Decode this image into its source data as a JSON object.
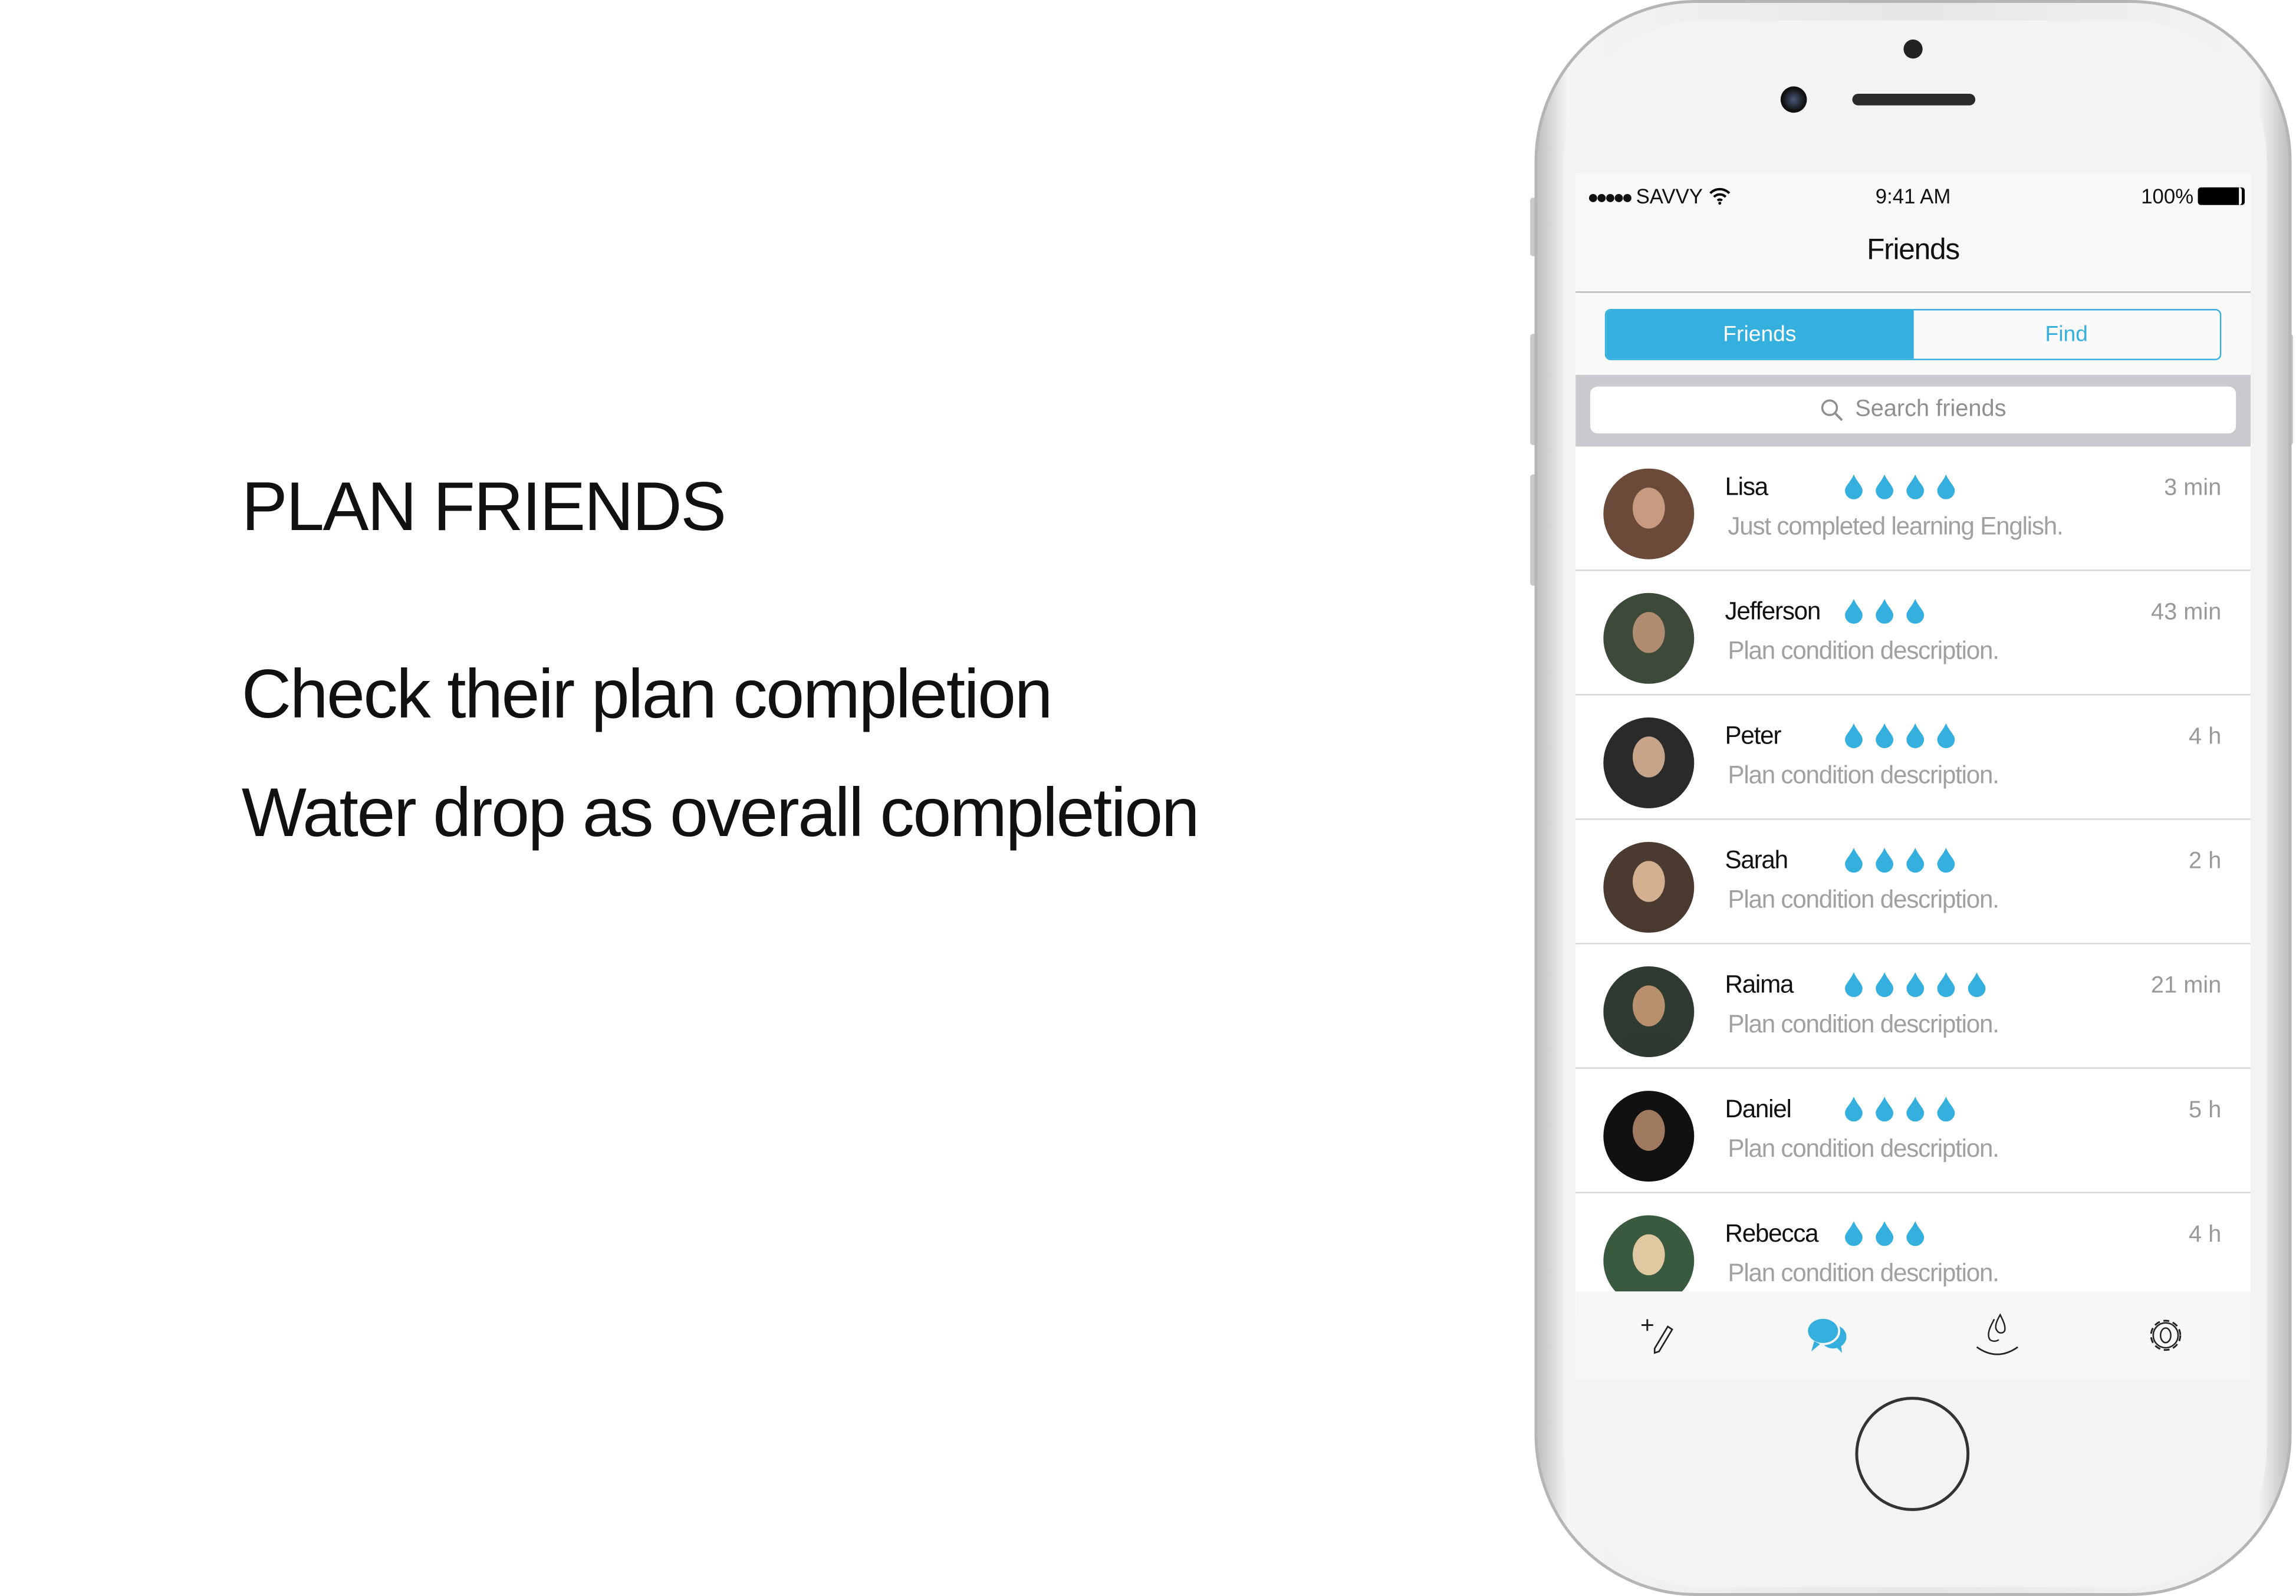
{
  "slide": {
    "headline": "PLAN FRIENDS",
    "lines": [
      "Check their plan completion",
      "Water drop as overall completion"
    ]
  },
  "status_bar": {
    "carrier": "SAVVY",
    "time": "9:41 AM",
    "battery": "100%"
  },
  "nav": {
    "title": "Friends"
  },
  "segments": {
    "friends": "Friends",
    "find": "Find",
    "selected": "Friends"
  },
  "search": {
    "placeholder": "Search friends"
  },
  "accent_color": "#35b0de",
  "friends": [
    {
      "name": "Lisa",
      "drops": 4,
      "time": "3 min",
      "desc": "Just completed learning English."
    },
    {
      "name": "Jefferson",
      "drops": 3,
      "time": "43 min",
      "desc": "Plan condition description."
    },
    {
      "name": "Peter",
      "drops": 4,
      "time": "4 h",
      "desc": "Plan condition description."
    },
    {
      "name": "Sarah",
      "drops": 4,
      "time": "2 h",
      "desc": "Plan condition description."
    },
    {
      "name": "Raima",
      "drops": 5,
      "time": "21 min",
      "desc": "Plan condition description."
    },
    {
      "name": "Daniel",
      "drops": 4,
      "time": "5 h",
      "desc": "Plan condition description."
    },
    {
      "name": "Rebecca",
      "drops": 3,
      "time": "4 h",
      "desc": "Plan condition description."
    }
  ],
  "tabs": [
    {
      "icon": "add-plan-icon"
    },
    {
      "icon": "chat-icon",
      "active": true
    },
    {
      "icon": "water-drop-icon"
    },
    {
      "icon": "gear-icon"
    }
  ]
}
